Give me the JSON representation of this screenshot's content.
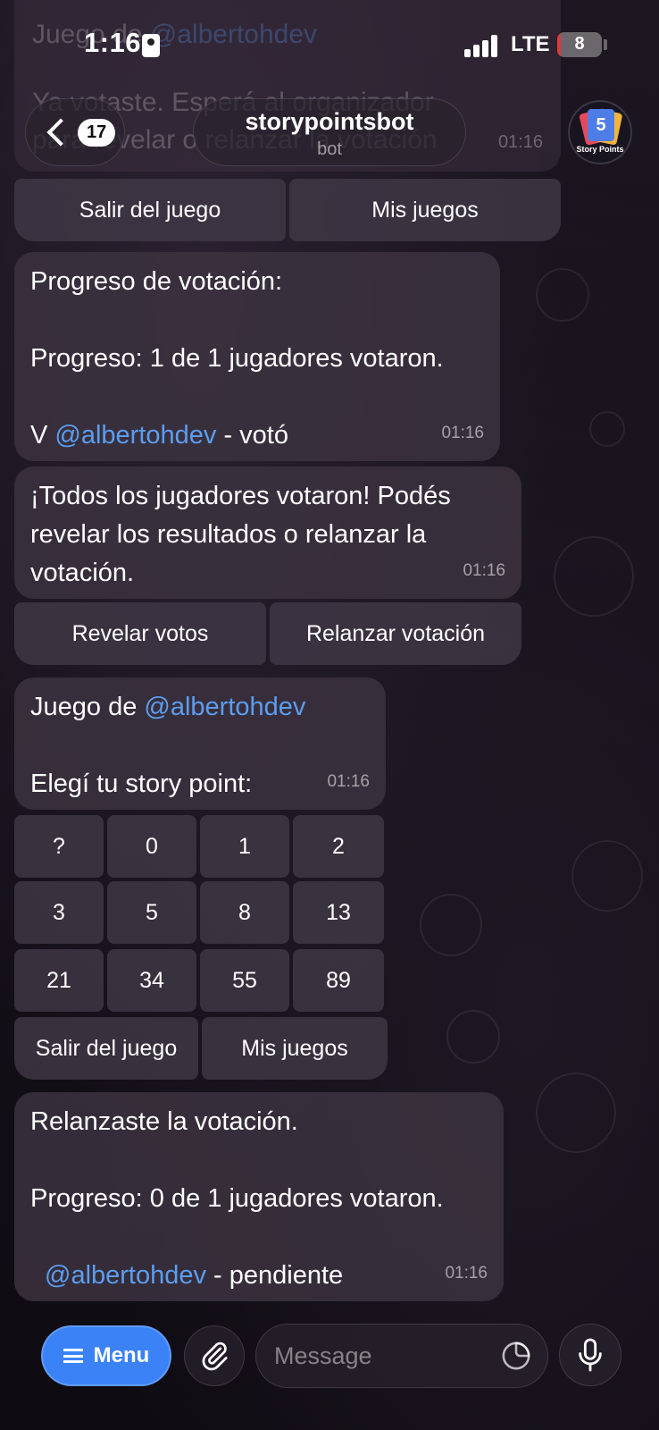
{
  "status_bar": {
    "time": "1:16",
    "network": "LTE",
    "battery": "8",
    "battery_level": 0.08
  },
  "header": {
    "back_count": "17",
    "title": "storypointsbot",
    "subtitle": "bot",
    "avatar_number": "5",
    "avatar_label": "Story Points"
  },
  "faded_message": {
    "line1_prefix": "Juego de ",
    "line1_mention": "@albertohdev",
    "line2": "Ya votaste. Esperá al organizador",
    "line3": "para revelar o relanzar la votación",
    "time": "01:16"
  },
  "top_keyboard": {
    "leave": "Salir del juego",
    "my_games": "Mis juegos"
  },
  "progress_message": {
    "line1": "Progreso de votación:",
    "line2": "Progreso: 1 de 1 jugadores votaron.",
    "voter_prefix": "V ",
    "voter_mention": "@albertohdev",
    "voter_suffix": " - votó",
    "time": "01:16"
  },
  "all_voted_message": {
    "line1": "¡Todos los jugadores votaron! Podés",
    "line2": "revelar los resultados o relanzar la",
    "line3": "votación.",
    "time": "01:16"
  },
  "reveal_keyboard": {
    "reveal": "Revelar votos",
    "relaunch": "Relanzar votación"
  },
  "game_message": {
    "line1_prefix": "Juego de ",
    "line1_mention": "@albertohdev",
    "line2": "Elegí tu story point:",
    "time": "01:16"
  },
  "points_keyboard": {
    "rows": [
      [
        "?",
        "0",
        "1",
        "2"
      ],
      [
        "3",
        "5",
        "8",
        "13"
      ],
      [
        "21",
        "34",
        "55",
        "89"
      ]
    ],
    "leave": "Salir del juego",
    "my_games": "Mis juegos"
  },
  "relaunch_message": {
    "line1": "Relanzaste la votación.",
    "line2": "Progreso: 0 de 1 jugadores votaron.",
    "pending_mention": "@albertohdev",
    "pending_suffix": " - pendiente",
    "time": "01:16"
  },
  "composer": {
    "menu": "Menu",
    "placeholder": "Message"
  }
}
